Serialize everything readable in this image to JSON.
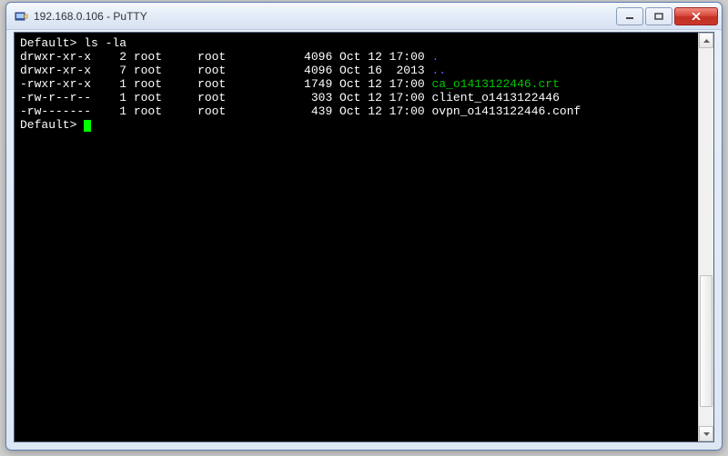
{
  "window": {
    "title": "192.168.0.106 - PuTTY"
  },
  "terminal": {
    "prompt": "Default>",
    "command": "ls -la",
    "rows": [
      {
        "perm": "drwxr-xr-x",
        "links": "2",
        "owner": "root",
        "group": "root",
        "size": "4096",
        "date": "Oct 12 17:00",
        "name": ".",
        "cls": "dir-link"
      },
      {
        "perm": "drwxr-xr-x",
        "links": "7",
        "owner": "root",
        "group": "root",
        "size": "4096",
        "date": "Oct 16  2013",
        "name": "..",
        "cls": "dir-link"
      },
      {
        "perm": "-rwxr-xr-x",
        "links": "1",
        "owner": "root",
        "group": "root",
        "size": "1749",
        "date": "Oct 12 17:00",
        "name": "ca_o1413122446.crt",
        "cls": "exec"
      },
      {
        "perm": "-rw-r--r--",
        "links": "1",
        "owner": "root",
        "group": "root",
        "size": "303",
        "date": "Oct 12 17:00",
        "name": "client_o1413122446",
        "cls": ""
      },
      {
        "perm": "-rw-------",
        "links": "1",
        "owner": "root",
        "group": "root",
        "size": "439",
        "date": "Oct 12 17:00",
        "name": "ovpn_o1413122446.conf",
        "cls": ""
      }
    ]
  }
}
